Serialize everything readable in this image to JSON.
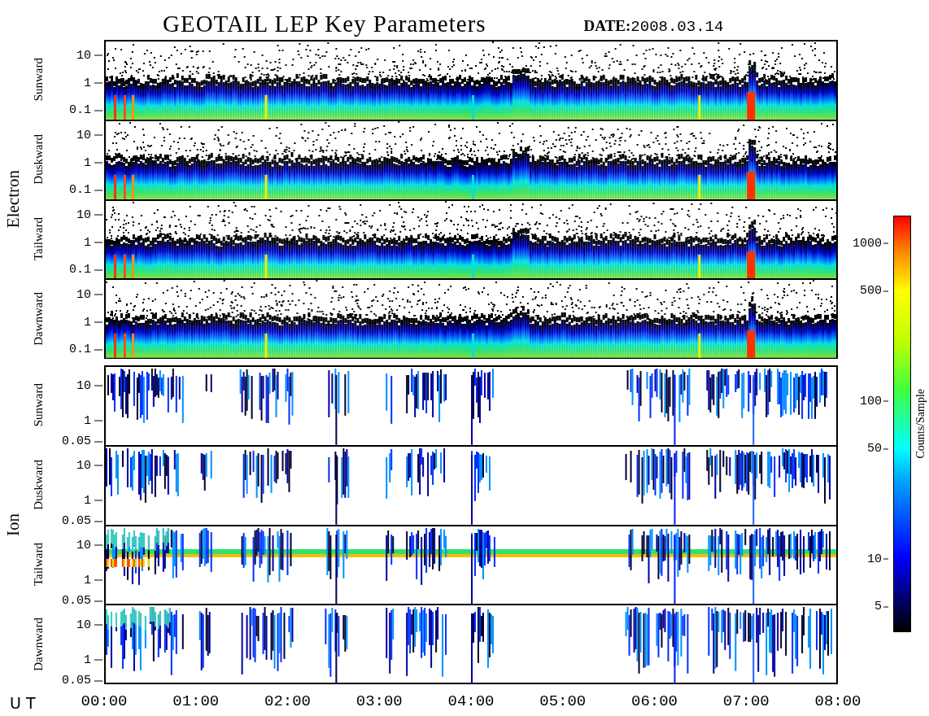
{
  "title": "GEOTAIL LEP Key Parameters",
  "date_label": "DATE:",
  "date": "2008.03.14",
  "groups": [
    {
      "kind": "electron",
      "label": "Electron",
      "panels": [
        {
          "label": "Sunward",
          "yticks": [
            "10",
            "1",
            "0.1"
          ]
        },
        {
          "label": "Duskward",
          "yticks": [
            "10",
            "1",
            "0.1"
          ]
        },
        {
          "label": "Tailward",
          "yticks": [
            "10",
            "1",
            "0.1"
          ]
        },
        {
          "label": "Dawnward",
          "yticks": [
            "10",
            "1",
            "0.1"
          ]
        }
      ]
    },
    {
      "kind": "ion",
      "label": "Ion",
      "panels": [
        {
          "label": "Sunward",
          "yticks": [
            "10",
            "1",
            "0.05"
          ]
        },
        {
          "label": "Duskward",
          "yticks": [
            "10",
            "1",
            "0.05"
          ]
        },
        {
          "label": "Tailward",
          "yticks": [
            "10",
            "1",
            "0.05"
          ]
        },
        {
          "label": "Dawnward",
          "yticks": [
            "10",
            "1",
            "0.05"
          ]
        }
      ]
    }
  ],
  "x_axis": {
    "label": "U T",
    "ticks": [
      "00:00",
      "01:00",
      "02:00",
      "03:00",
      "04:00",
      "05:00",
      "06:00",
      "07:00",
      "08:00"
    ]
  },
  "colorbar": {
    "label": "Counts/Sample",
    "ticks": [
      "1000",
      "500",
      "100",
      "50",
      "10",
      "5"
    ]
  }
}
